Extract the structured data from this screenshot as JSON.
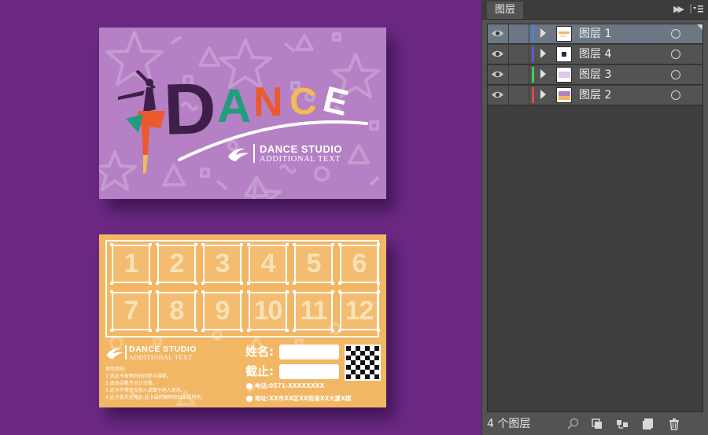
{
  "artwork": {
    "front": {
      "title_letters": [
        {
          "char": "D",
          "color": "#3e1f4a"
        },
        {
          "char": "A",
          "color": "#1e9e7e"
        },
        {
          "char": "N",
          "color": "#ea5a2c"
        },
        {
          "char": "C",
          "color": "#f4bb54"
        },
        {
          "char": "E",
          "color": "#ffffff"
        }
      ],
      "studio_name": "DANCE STUDIO",
      "studio_sub": "ADDITIONAL TEXT"
    },
    "back": {
      "numbers": [
        "1",
        "2",
        "3",
        "4",
        "5",
        "6",
        "7",
        "8",
        "9",
        "10",
        "11",
        "12"
      ],
      "studio_name": "DANCE STUDIO",
      "studio_sub": "ADDITIONAL TEXT",
      "name_label": "姓名:",
      "expire_label": "截止:",
      "notes": [
        "使用须知:",
        "1.凭此卡按预约时间参与课程。",
        "2.由本店教专员计次数。",
        "3.此卡不得转交他人或赠予他人使用。",
        "4.此卡丢失无补办,此卡最终解释权归本店所有。"
      ],
      "phone": "电话:0571-XXXXXXXX",
      "address": "地址:XX市XX区XX街道XX大厦X楼"
    }
  },
  "panel": {
    "tab_label": "图层",
    "layers": [
      {
        "name": "图层 1",
        "color": "#4a7fe0",
        "selected": true
      },
      {
        "name": "图层 4",
        "color": "#5a5ad8",
        "selected": false
      },
      {
        "name": "图层 3",
        "color": "#3fd14f",
        "selected": false
      },
      {
        "name": "图层 2",
        "color": "#e04848",
        "selected": false
      }
    ],
    "layer_count": "4 个图层"
  }
}
